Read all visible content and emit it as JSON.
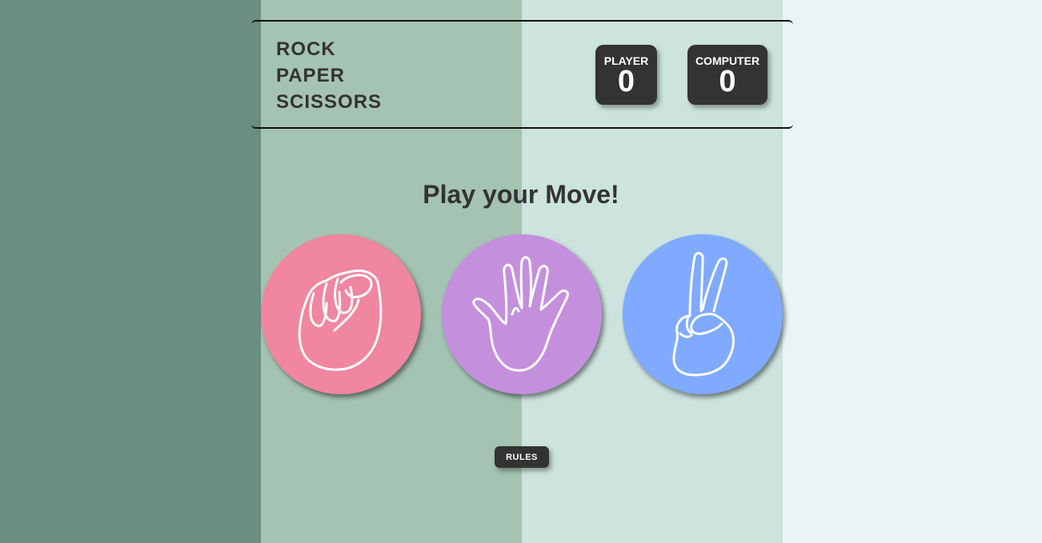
{
  "header": {
    "title_lines": [
      "ROCK",
      "PAPER",
      "SCISSORS"
    ],
    "player": {
      "label": "PLAYER",
      "score": "0"
    },
    "computer": {
      "label": "COMPUTER",
      "score": "0"
    }
  },
  "main": {
    "prompt": "Play your Move!",
    "choices": [
      {
        "name": "rock",
        "icon": "fist-hand-icon",
        "color": "#f0869f"
      },
      {
        "name": "paper",
        "icon": "open-hand-icon",
        "color": "#c490dd"
      },
      {
        "name": "scissors",
        "icon": "peace-hand-icon",
        "color": "#7faaff"
      }
    ]
  },
  "footer": {
    "rules_label": "RULES"
  },
  "colors": {
    "column_1": "#6a8e7f",
    "column_2": "#a4c3b2",
    "column_3": "#cce3de",
    "column_4": "#eaf4f4",
    "dark": "#333331"
  }
}
